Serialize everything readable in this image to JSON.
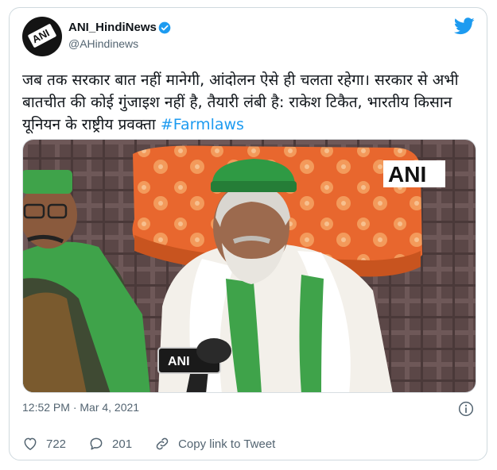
{
  "account": {
    "name": "ANI_HindiNews",
    "handle": "@AHindinews",
    "avatar_text": "ANI"
  },
  "tweet": {
    "text": "जब तक सरकार बात नहीं मानेगी, आंदोलन ऐसे ही चलता रहेगा। सरकार से अभी बातचीत की कोई गुंजाइश नहीं है, तैयारी लंबी है: राकेश टिकैत, भारतीय किसान यूनियन के राष्ट्रीय प्रवक्ता ",
    "hashtag": "#Farmlaws",
    "timestamp": "12:52 PM · Mar 4, 2021"
  },
  "media": {
    "watermark": "ANI",
    "mic_label": "ANI"
  },
  "actions": {
    "likes": "722",
    "replies": "201",
    "copy_link": "Copy link to Tweet"
  },
  "colors": {
    "link": "#1d9bf0",
    "text": "#0f1419",
    "muted": "#536471",
    "border": "#cfd9de"
  }
}
